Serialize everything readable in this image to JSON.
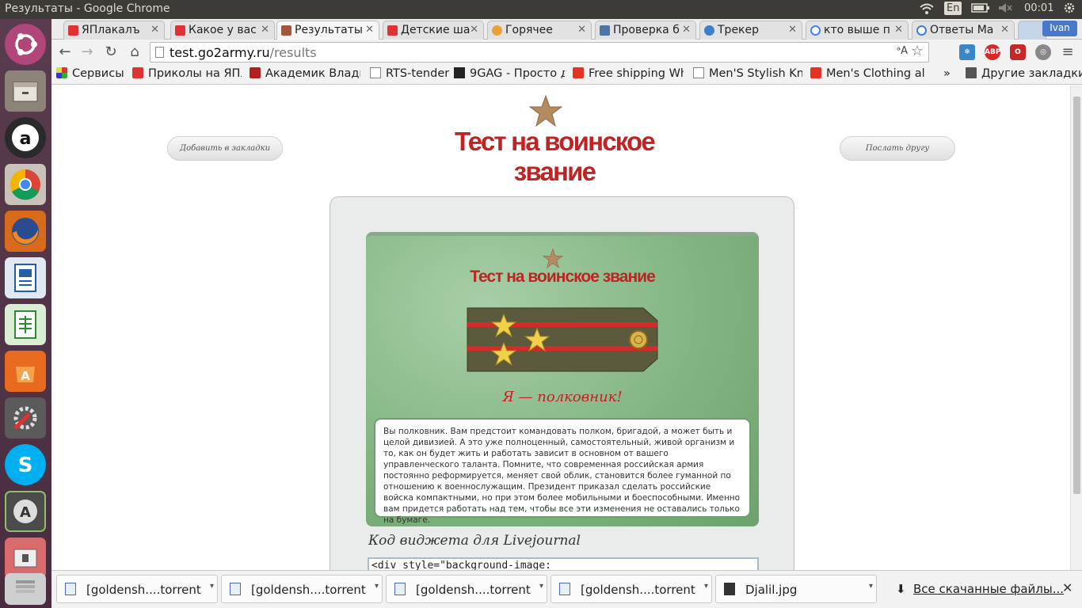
{
  "window": {
    "title": "Результаты - Google Chrome"
  },
  "panel": {
    "lang": "En",
    "clock": "00:01",
    "user": "Ivan"
  },
  "tabs": [
    {
      "label": "ЯПлакалъ"
    },
    {
      "label": "Какое у вас"
    },
    {
      "label": "Результаты"
    },
    {
      "label": "Детские ша"
    },
    {
      "label": "Горячее"
    },
    {
      "label": "Проверка б"
    },
    {
      "label": "Трекер"
    },
    {
      "label": "кто выше п"
    },
    {
      "label": "Ответы Ma"
    }
  ],
  "address": {
    "host": "test.go2army.ru",
    "path": "/results"
  },
  "bookmarks": [
    {
      "label": "Сервисы"
    },
    {
      "label": "Приколы на ЯПл"
    },
    {
      "label": "Академик Влади"
    },
    {
      "label": "RTS-tender"
    },
    {
      "label": "9GAG - Просто дл"
    },
    {
      "label": "Free shipping Wh"
    },
    {
      "label": "Men'S Stylish Knit"
    },
    {
      "label": "Men's Clothing al"
    }
  ],
  "bookmarks_more": "»",
  "bookmarks_other": "Другие закладки",
  "page": {
    "bookmark_button": "Добавить в закладки",
    "send_button": "Послать другу",
    "logo_text": "Тест на воинское звание",
    "card_title": "Тест на воинское звание",
    "rank_result": "Я — полковник!",
    "description": "Вы полковник. Вам предстоит командовать полком, бригадой, а может быть и целой дивизией. А это уже полноценный, самостоятельный, живой организм и то, как он будет жить и работать зависит в основном от вашего управленческого таланта. Помните, что современная российская армия постоянно реформируется, меняет свой облик, становится более гуманной по отношению к военнослужащим. Президент приказал сделать российские войска компактными, но при этом более мобильными и боеспособными. Именно вам придется работать над тем, чтобы все эти изменения не оставались только на бумаге.",
    "widget_title": "Код виджета для Livejournal",
    "widget_code": "<div style=\"background-image:"
  },
  "downloads": [
    {
      "name": "[goldensh....torrent"
    },
    {
      "name": "[goldensh....torrent"
    },
    {
      "name": "[goldensh....torrent"
    },
    {
      "name": "[goldensh....torrent"
    },
    {
      "name": "Djalil.jpg"
    }
  ],
  "downloads_all": "Все скачанные файлы...",
  "colors": {
    "accent_red": "#c12222",
    "camo_green": "#7fb27f",
    "launcher": "#4a2c40"
  }
}
